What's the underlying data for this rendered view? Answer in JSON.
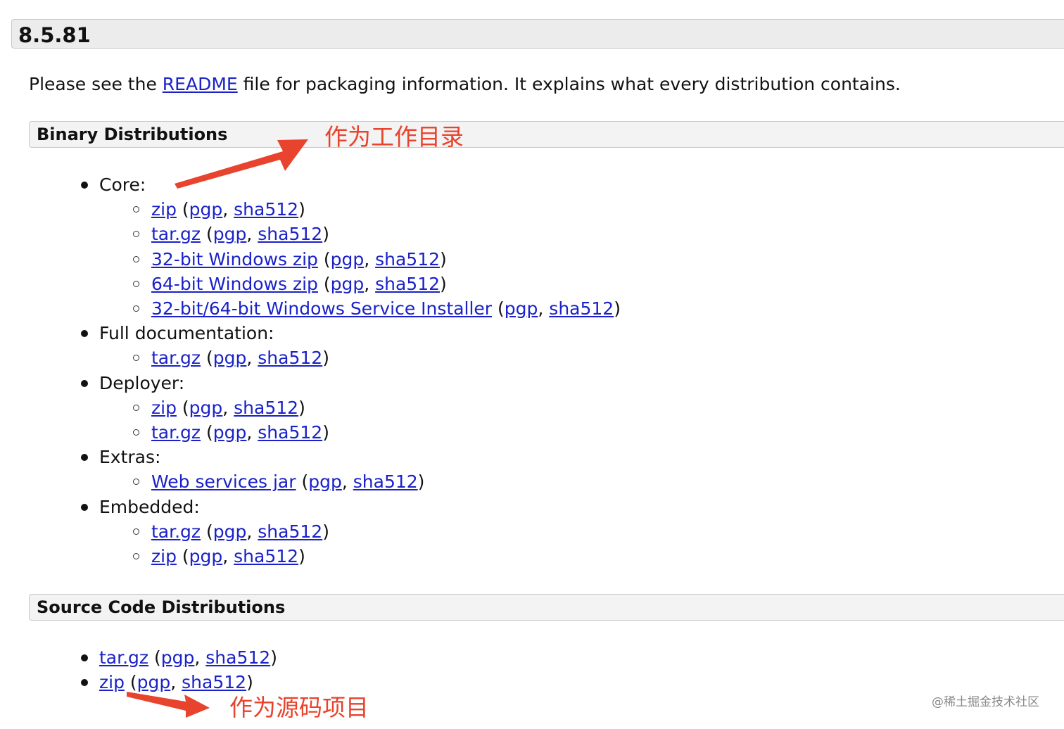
{
  "version": "8.5.81",
  "intro": {
    "before": "Please see the ",
    "link": "README",
    "after": " file for packaging information. It explains what every distribution contains."
  },
  "binary": {
    "title": "Binary Distributions",
    "groups": [
      {
        "label": "Core:",
        "items": [
          {
            "main": "zip",
            "pgp": "pgp",
            "sha": "sha512"
          },
          {
            "main": "tar.gz",
            "pgp": "pgp",
            "sha": "sha512"
          },
          {
            "main": "32-bit Windows zip",
            "pgp": "pgp",
            "sha": "sha512"
          },
          {
            "main": "64-bit Windows zip",
            "pgp": "pgp",
            "sha": "sha512"
          },
          {
            "main": "32-bit/64-bit Windows Service Installer",
            "pgp": "pgp",
            "sha": "sha512"
          }
        ]
      },
      {
        "label": "Full documentation:",
        "items": [
          {
            "main": "tar.gz",
            "pgp": "pgp",
            "sha": "sha512"
          }
        ]
      },
      {
        "label": "Deployer:",
        "items": [
          {
            "main": "zip",
            "pgp": "pgp",
            "sha": "sha512"
          },
          {
            "main": "tar.gz",
            "pgp": "pgp",
            "sha": "sha512"
          }
        ]
      },
      {
        "label": "Extras:",
        "items": [
          {
            "main": "Web services jar",
            "pgp": "pgp",
            "sha": "sha512"
          }
        ]
      },
      {
        "label": "Embedded:",
        "items": [
          {
            "main": "tar.gz",
            "pgp": "pgp",
            "sha": "sha512"
          },
          {
            "main": "zip",
            "pgp": "pgp",
            "sha": "sha512"
          }
        ]
      }
    ]
  },
  "source": {
    "title": "Source Code Distributions",
    "items": [
      {
        "main": "tar.gz",
        "pgp": "pgp",
        "sha": "sha512"
      },
      {
        "main": "zip",
        "pgp": "pgp",
        "sha": "sha512"
      }
    ]
  },
  "annotations": {
    "binary_note": "作为工作目录",
    "source_note": "作为源码项目",
    "color": "#e8432c"
  },
  "watermark": "@稀土掘金技术社区",
  "colors": {
    "link": "#1a22c8",
    "header_bg": "#ececec"
  }
}
